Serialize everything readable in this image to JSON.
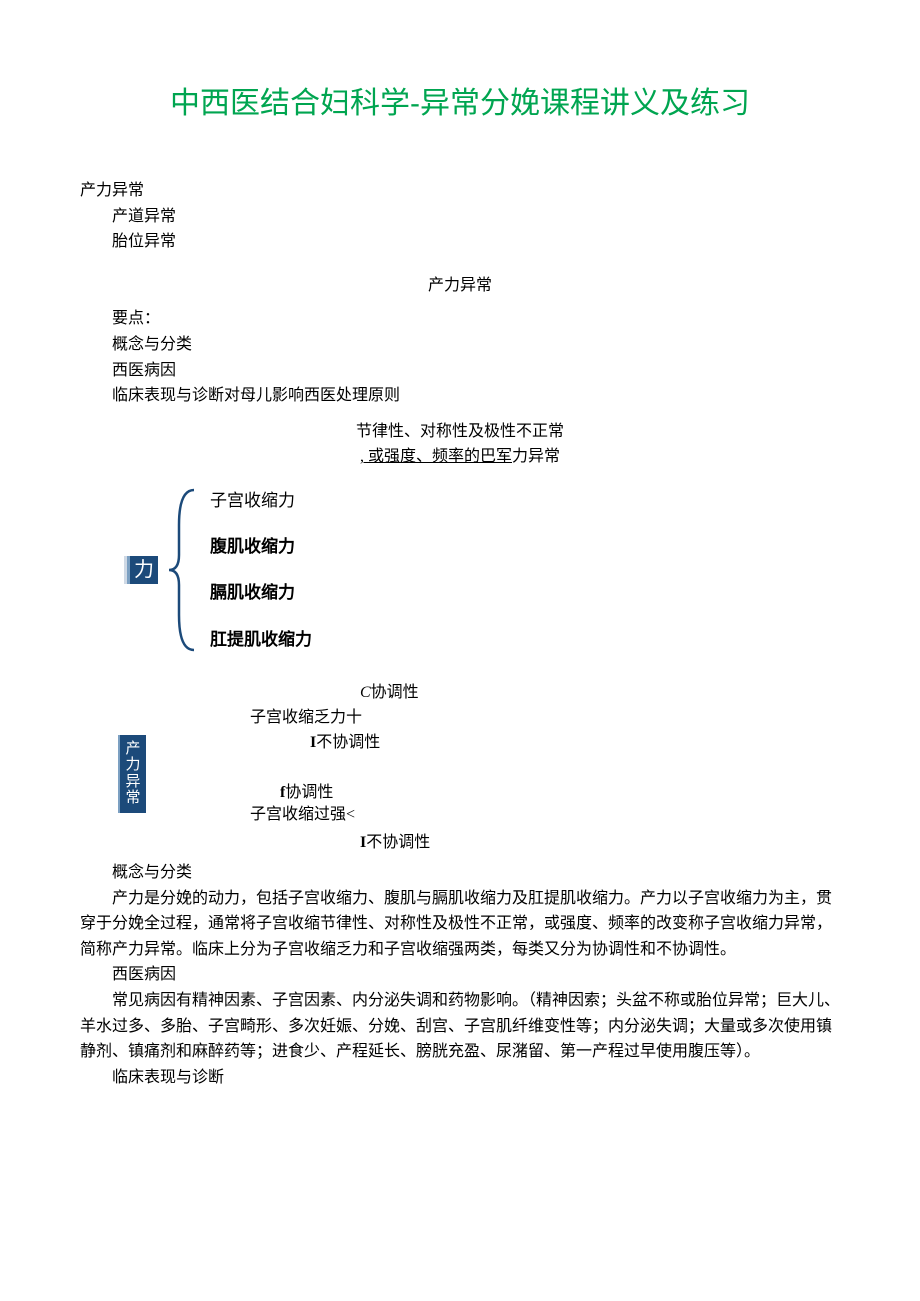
{
  "title": "中西医结合妇科学-异常分娩课程讲义及练习",
  "intro": {
    "line1": "产力异常",
    "line2": "产道异常",
    "line3": "胎位异常"
  },
  "section1": {
    "heading": "产力异常",
    "points_label": "要点：",
    "p1": "概念与分类",
    "p2": "西医病因",
    "p3": "临床表现与诊断对母儿影响西医处理原则"
  },
  "diagram1": {
    "note1": "节律性、对称性及极性不正常",
    "note2_a": ", 或强度、频率的巴军",
    "note2_b": "力异常",
    "box": "力",
    "item1": "子宫收缩力",
    "item2": "腹肌收缩力",
    "item3": "膈肌收缩力",
    "item4": "肛提肌收缩力"
  },
  "diagram2": {
    "line1_a": "C",
    "line1_b": "协调性",
    "line2": "子宫收缩乏力十",
    "line3_a": "I",
    "line3_b": "不协调性",
    "pill": "产力异常",
    "line4_a": "f",
    "line4_b": "协调性",
    "line5": "子宫收缩过强<",
    "line6_a": "I",
    "line6_b": "不协调性"
  },
  "body": {
    "h1": "概念与分类",
    "p1": "产力是分娩的动力，包括子宫收缩力、腹肌与膈肌收缩力及肛提肌收缩力。产力以子宫收缩力为主，贯穿于分娩全过程，通常将子宫收缩节律性、对称性及极性不正常，或强度、频率的改变称子宫收缩力异常，简称产力异常。临床上分为子宫收缩乏力和子宫收缩强两类，每类又分为协调性和不协调性。",
    "h2": "西医病因",
    "p2": "常见病因有精神因素、子宫因素、内分泌失调和药物影响。（精神因索；头盆不称或胎位异常；巨大儿、羊水过多、多胎、子宫畸形、多次妊娠、分娩、刮宫、子宫肌纤维变性等；内分泌失调；大量或多次使用镇静剂、镇痛剂和麻醉药等；进食少、产程延长、膀胱充盈、尿潴留、第一产程过早使用腹压等）。",
    "h3": "临床表现与诊断"
  }
}
